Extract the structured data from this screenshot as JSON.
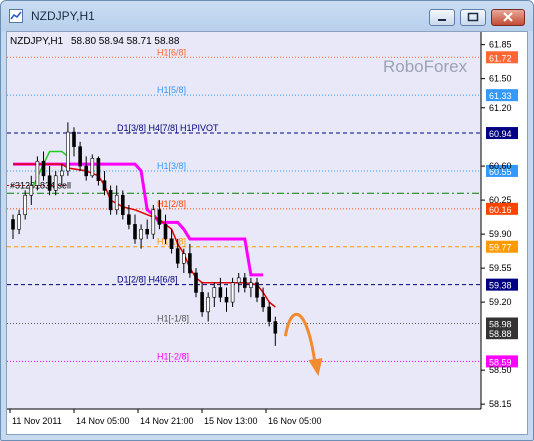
{
  "window": {
    "title": "NZDJPY,H1",
    "controls": {
      "minimize_icon": "minimize-icon",
      "maximize_icon": "maximize-icon",
      "close_icon": "close-icon"
    }
  },
  "chart_header": {
    "symbol": "NZDJPY,H1",
    "ohlc": "58.80 58.94 58.71 58.88"
  },
  "watermark": "RoboForex",
  "colors": {
    "background": "#e8e8f8",
    "candles": "#000000",
    "red_line": "#e00000",
    "magenta_line": "#ff00ff",
    "green_line": "#22cc22",
    "arrow": "#f28a2e"
  },
  "chart_data": {
    "type": "line",
    "y_axis_ticks": [
      "61.85",
      "61.50",
      "61.20",
      "60.60",
      "60.25",
      "59.90",
      "59.55",
      "59.20",
      "58.50",
      "58.15"
    ],
    "x_axis_ticks": [
      "11 Nov 2011",
      "14 Nov 05:00",
      "14 Nov 21:00",
      "15 Nov 13:00",
      "16 Nov 05:00"
    ],
    "ylim": [
      58.1,
      61.98
    ],
    "price_levels": [
      {
        "label": "H1[6/8]",
        "price": 61.72,
        "price_label": "61.72",
        "color": "#ff6633",
        "style": "dotted"
      },
      {
        "label": "H1[5/8]",
        "price": 61.33,
        "price_label": "61.33",
        "color": "#3399ff",
        "style": "dotted"
      },
      {
        "label": "D1[3/8] H4[7/8] H1PIVOT",
        "price": 60.94,
        "price_label": "60.94",
        "color": "#000080",
        "style": "dashed"
      },
      {
        "label": "H1[3/8]",
        "price": 60.55,
        "price_label": "60.55",
        "color": "#3399ff",
        "style": "dotted"
      },
      {
        "label": "",
        "price": 60.32,
        "price_label": "",
        "color": "#008000",
        "style": "dashdot"
      },
      {
        "label": "H1[2/8]",
        "price": 60.16,
        "price_label": "60.16",
        "color": "#ff4400",
        "style": "dotted"
      },
      {
        "label": "H1[1/8]",
        "price": 59.77,
        "price_label": "59.77",
        "color": "#ff9900",
        "style": "dashed"
      },
      {
        "label": "D1[2/8] H4[6/8]",
        "price": 59.38,
        "price_label": "59.38",
        "color": "#000080",
        "style": "dashed"
      },
      {
        "label": "H1[-1/8]",
        "price": 58.98,
        "price_label": "",
        "color": "#555555",
        "style": "dotted"
      },
      {
        "label": "H1[-2/8]",
        "price": 58.59,
        "price_label": "58.59",
        "color": "#ff00ff",
        "style": "dotted"
      }
    ],
    "current_price_labels": [
      {
        "price": 58.98,
        "price_label": "58.98",
        "color": "#333333"
      },
      {
        "price": 58.88,
        "price_label": "58.88",
        "color": "#333333"
      }
    ],
    "order_label": "#31261834 sell",
    "order_price": 60.4,
    "candles": [
      [
        60.05,
        60.1,
        59.85,
        59.95
      ],
      [
        59.95,
        60.15,
        59.9,
        60.1
      ],
      [
        60.1,
        60.35,
        60.05,
        60.3
      ],
      [
        60.3,
        60.5,
        60.2,
        60.4
      ],
      [
        60.4,
        60.7,
        60.35,
        60.65
      ],
      [
        60.65,
        60.75,
        60.45,
        60.5
      ],
      [
        60.5,
        60.6,
        60.3,
        60.35
      ],
      [
        60.35,
        60.55,
        60.3,
        60.5
      ],
      [
        60.5,
        60.62,
        60.4,
        60.55
      ],
      [
        60.55,
        61.05,
        60.5,
        60.95
      ],
      [
        60.95,
        61.0,
        60.7,
        60.8
      ],
      [
        60.8,
        60.85,
        60.55,
        60.6
      ],
      [
        60.6,
        60.7,
        60.45,
        60.5
      ],
      [
        60.5,
        60.72,
        60.48,
        60.68
      ],
      [
        60.68,
        60.7,
        60.4,
        60.45
      ],
      [
        60.45,
        60.55,
        60.3,
        60.35
      ],
      [
        60.35,
        60.4,
        60.1,
        60.15
      ],
      [
        60.15,
        60.4,
        60.1,
        60.3
      ],
      [
        60.3,
        60.35,
        60.05,
        60.1
      ],
      [
        60.1,
        60.2,
        59.95,
        60.0
      ],
      [
        60.0,
        60.1,
        59.8,
        59.85
      ],
      [
        59.85,
        60.0,
        59.75,
        59.95
      ],
      [
        59.95,
        60.05,
        59.85,
        59.9
      ],
      [
        59.9,
        60.2,
        59.85,
        60.15
      ],
      [
        60.15,
        60.25,
        59.95,
        60.0
      ],
      [
        60.0,
        60.1,
        59.8,
        59.85
      ],
      [
        59.85,
        59.95,
        59.7,
        59.75
      ],
      [
        59.75,
        59.85,
        59.55,
        59.6
      ],
      [
        59.6,
        59.75,
        59.5,
        59.7
      ],
      [
        59.7,
        59.8,
        59.45,
        59.5
      ],
      [
        59.5,
        59.55,
        59.25,
        59.3
      ],
      [
        59.3,
        59.4,
        59.05,
        59.1
      ],
      [
        59.1,
        59.3,
        59.0,
        59.25
      ],
      [
        59.25,
        59.4,
        59.15,
        59.35
      ],
      [
        59.35,
        59.45,
        59.2,
        59.25
      ],
      [
        59.25,
        59.35,
        59.1,
        59.2
      ],
      [
        59.2,
        59.45,
        59.15,
        59.4
      ],
      [
        59.4,
        59.5,
        59.3,
        59.45
      ],
      [
        59.45,
        59.5,
        59.3,
        59.35
      ],
      [
        59.35,
        59.45,
        59.25,
        59.4
      ],
      [
        59.4,
        59.45,
        59.2,
        59.25
      ],
      [
        59.25,
        59.35,
        59.1,
        59.15
      ],
      [
        59.15,
        59.2,
        58.95,
        59.0
      ],
      [
        59.0,
        59.05,
        58.75,
        58.88
      ]
    ],
    "red_line": [
      [
        0,
        60.62
      ],
      [
        8,
        60.62
      ],
      [
        9,
        60.58
      ],
      [
        12,
        60.55
      ],
      [
        14,
        60.5
      ],
      [
        15,
        60.4
      ],
      [
        16,
        60.25
      ],
      [
        18,
        60.18
      ],
      [
        20,
        60.15
      ],
      [
        22,
        60.1
      ],
      [
        24,
        60.05
      ],
      [
        26,
        59.95
      ],
      [
        27,
        59.8
      ],
      [
        28,
        59.7
      ],
      [
        29,
        59.55
      ],
      [
        30,
        59.45
      ],
      [
        31,
        59.4
      ],
      [
        36,
        59.4
      ],
      [
        38,
        59.4
      ],
      [
        40,
        59.38
      ],
      [
        41,
        59.3
      ],
      [
        42,
        59.2
      ],
      [
        43,
        59.15
      ]
    ],
    "magenta_line": [
      [
        0,
        60.62
      ],
      [
        7,
        60.62
      ],
      [
        9,
        60.62
      ],
      [
        20,
        60.62
      ],
      [
        21,
        60.55
      ],
      [
        22,
        60.15
      ],
      [
        23,
        60.1
      ],
      [
        24,
        60.02
      ],
      [
        27,
        60.02
      ],
      [
        28,
        59.95
      ],
      [
        29,
        59.85
      ],
      [
        38,
        59.85
      ],
      [
        39,
        59.48
      ],
      [
        41,
        59.48
      ]
    ],
    "green_line": [
      [
        3,
        60.35
      ],
      [
        5,
        60.62
      ],
      [
        6,
        60.75
      ],
      [
        8,
        60.75
      ],
      [
        9,
        60.7
      ]
    ],
    "forecast_arrow": "down"
  }
}
